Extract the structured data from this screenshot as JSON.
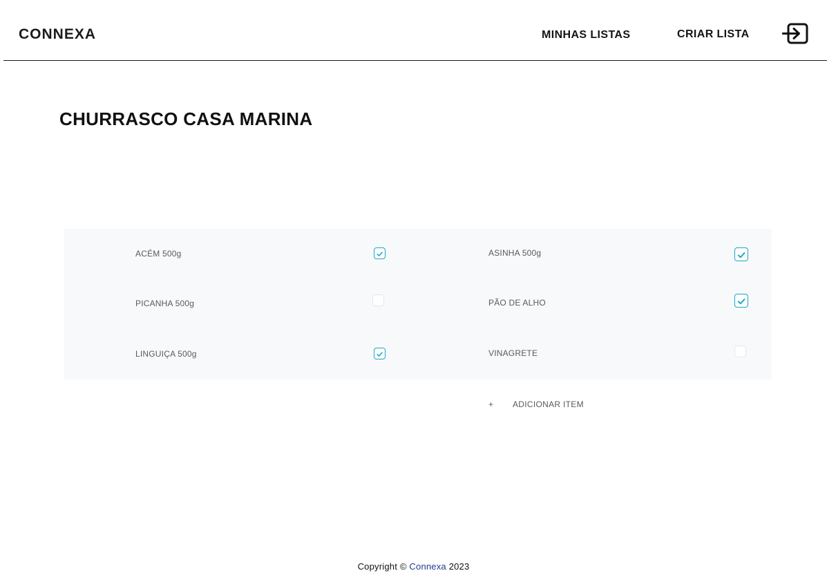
{
  "header": {
    "logo": "CONNEXA",
    "nav": {
      "my_lists": "MINHAS LISTAS",
      "create_list": "CRIAR LISTA"
    },
    "logout_icon": "logout-icon"
  },
  "page": {
    "title": "CHURRASCO CASA MARINA"
  },
  "items": [
    {
      "label": "ACÉM 500g",
      "checked": true
    },
    {
      "label": "PICANHA 500g",
      "checked": false
    },
    {
      "label": "LINGUIÇA 500g",
      "checked": true
    },
    {
      "label": "ASINHA 500g",
      "checked": true
    },
    {
      "label": "PÃO DE ALHO",
      "checked": true
    },
    {
      "label": "VINAGRETE",
      "checked": false
    }
  ],
  "add_item": {
    "icon": "+",
    "label": "ADICIONAR ITEM"
  },
  "footer": {
    "prefix": "Copyright ©",
    "brand": "Connexa",
    "year": "2023"
  },
  "colors": {
    "accent": "#1aa6c6",
    "panel": "#f8f9fa",
    "footer_brand": "#1f3b8f"
  }
}
